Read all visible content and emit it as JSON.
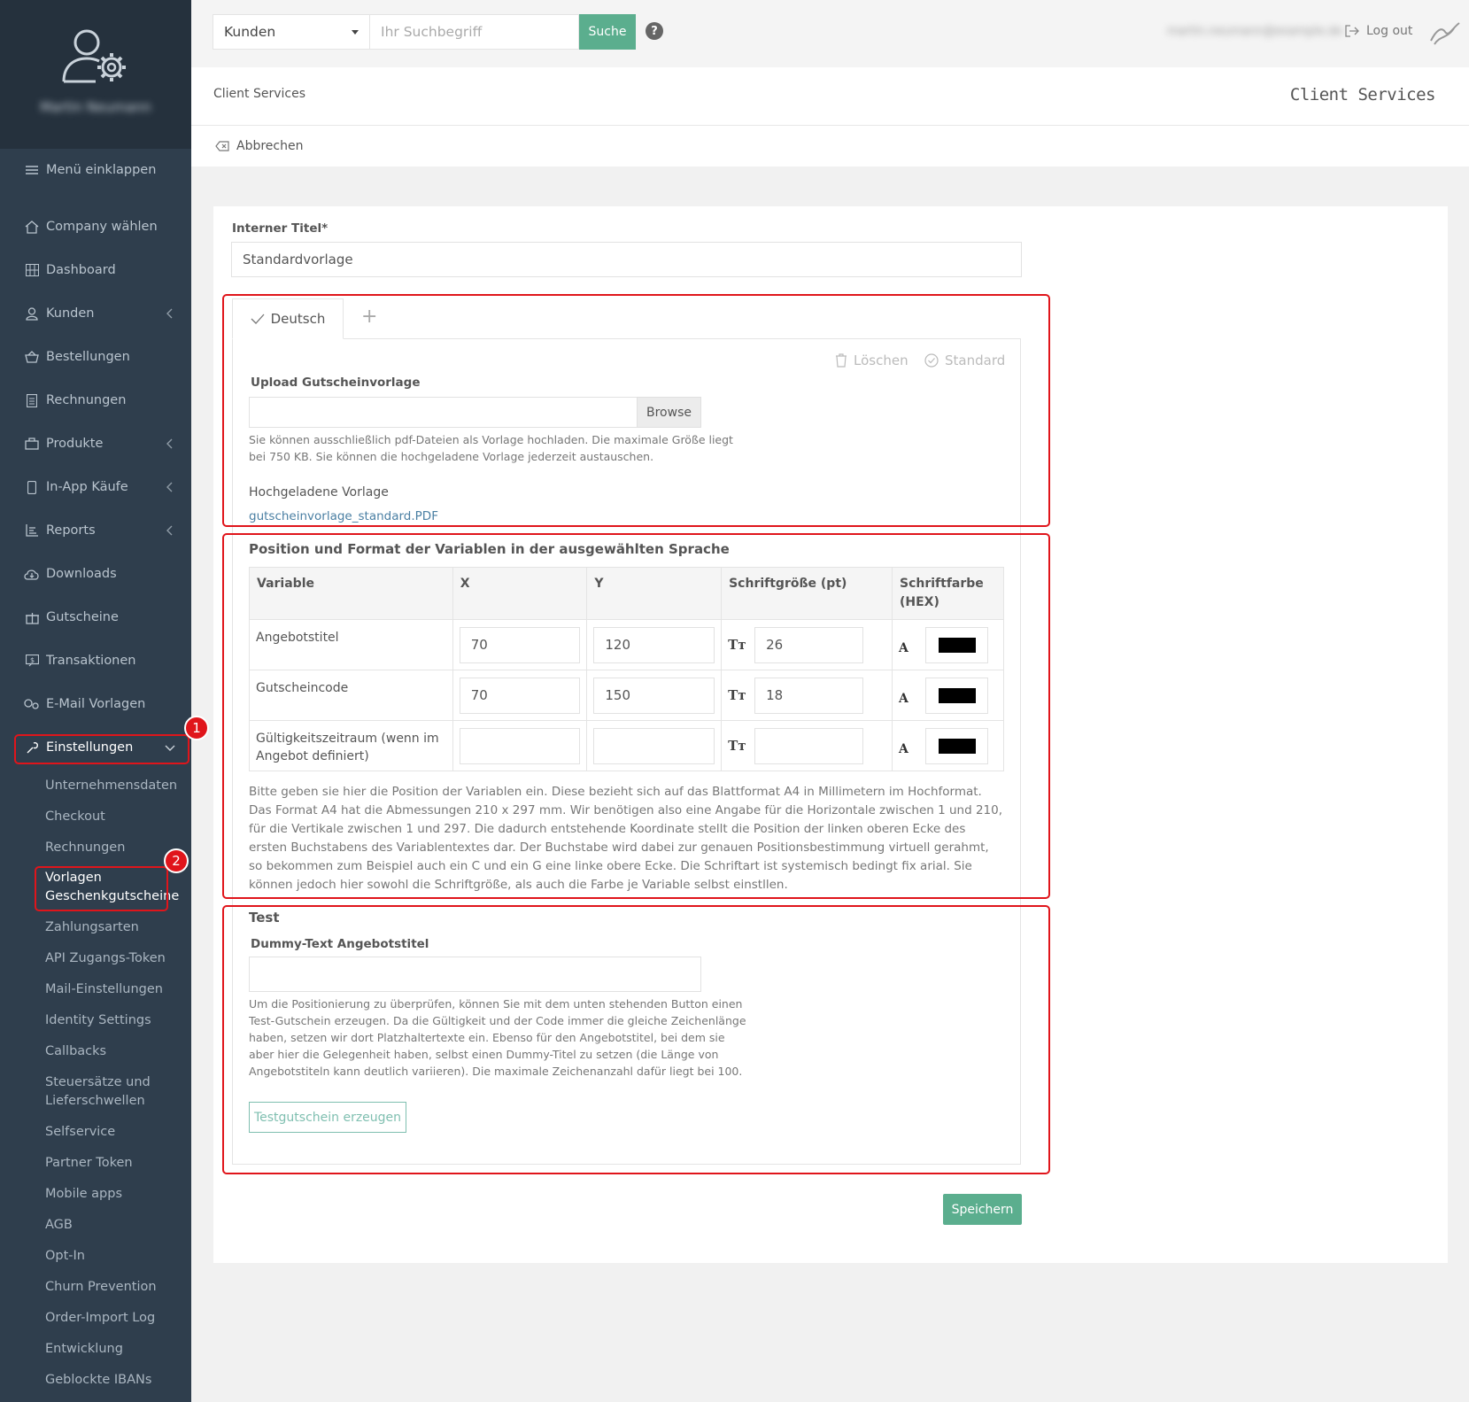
{
  "sidebar": {
    "user_name": "Martin Neumann",
    "collapse": "Menü einklappen",
    "items": [
      {
        "label": "Company wählen",
        "icon": "home-icon"
      },
      {
        "label": "Dashboard",
        "icon": "grid-icon"
      },
      {
        "label": "Kunden",
        "icon": "user-icon"
      },
      {
        "label": "Bestellungen",
        "icon": "basket-icon"
      },
      {
        "label": "Rechnungen",
        "icon": "invoice-icon"
      },
      {
        "label": "Produkte",
        "icon": "box-icon"
      },
      {
        "label": "In-App Käufe",
        "icon": "phone-icon"
      },
      {
        "label": "Reports",
        "icon": "report-icon"
      },
      {
        "label": "Downloads",
        "icon": "cloud-download-icon"
      },
      {
        "label": "Gutscheine",
        "icon": "gift-icon"
      },
      {
        "label": "Transaktionen",
        "icon": "transaction-icon"
      },
      {
        "label": "E-Mail Vorlagen",
        "icon": "mail-template-icon"
      },
      {
        "label": "Einstellungen",
        "icon": "wrench-icon"
      }
    ],
    "sub_items": [
      "Unternehmensdaten",
      "Checkout",
      "Rechnungen",
      "Vorlagen Geschenkgutscheine",
      "Zahlungsarten",
      "API Zugangs-Token",
      "Mail-Einstellungen",
      "Identity Settings",
      "Callbacks",
      "Steuersätze und Lieferschwellen",
      "Selfservice",
      "Partner Token",
      "Mobile apps",
      "AGB",
      "Opt-In",
      "Churn Prevention",
      "Order-Import Log",
      "Entwicklung",
      "Geblockte IBANs"
    ],
    "sub_active_line1": "Vorlagen",
    "sub_active_line2": "Geschenkgutscheine",
    "sub_multi_line1": "Steuersätze und",
    "sub_multi_line2": "Lieferschwellen",
    "badge1": "1",
    "badge2": "2"
  },
  "topbar": {
    "select_value": "Kunden",
    "search_placeholder": "Ihr Suchbegriff",
    "search_button": "Suche",
    "help": "?",
    "user_email": "martin.neumann@example.de",
    "logout": "Log out"
  },
  "breadcrumb": "Client Services",
  "header_right": "Client Services",
  "cancel": "Abbrechen",
  "form": {
    "title_label": "Interner Titel",
    "title_required": "*",
    "title_value": "Standardvorlage",
    "tab_active": "Deutsch",
    "tab_add": "+",
    "delete": "Löschen",
    "standard": "Standard",
    "upload_label": "Upload Gutscheinvorlage",
    "browse": "Browse",
    "upload_help_1": "Sie können ausschließlich pdf-Dateien als Vorlage hochladen. Die maximale Größe liegt",
    "upload_help_2": "bei 750 KB. Sie können die hochgeladene Vorlage jederzeit austauschen.",
    "uploaded_label": "Hochgeladene Vorlage",
    "uploaded_file": "gutscheinvorlage_standard.PDF",
    "section_title": "Position und Format der Variablen in der ausgewählten Sprache",
    "columns": [
      "Variable",
      "X",
      "Y",
      "Schriftgröße (pt)",
      "Schriftfarbe (HEX)"
    ],
    "col5_line1": "Schriftfarbe",
    "col5_line2": "(HEX)",
    "rows": [
      {
        "name": "Angebotstitel",
        "x": "70",
        "y": "120",
        "size": "26",
        "color": "#000000"
      },
      {
        "name": "Gutscheincode",
        "x": "70",
        "y": "150",
        "size": "18",
        "color": "#000000"
      },
      {
        "name": "Gültigkeitszeitraum (wenn im Angebot definiert)",
        "x": "",
        "y": "",
        "size": "",
        "color": "#000000"
      }
    ],
    "row3_line1": "Gültigkeitszeitraum (wenn im",
    "row3_line2": "Angebot definiert)",
    "position_help": "Bitte geben sie hier die Position der Variablen ein. Diese bezieht sich auf das Blattformat A4 in Millimetern im Hochformat. Das Format A4 hat die Abmessungen 210 x 297 mm. Wir benötigen also eine Angabe für die Horizontale zwischen 1 und 210, für die Vertikale zwischen 1 und 297. Die dadurch entstehende Koordinate stellt die Position der linken oberen Ecke des ersten Buchstabens des Variablentextes dar. Der Buchstabe wird dabei zur genauen Positionsbestimmung virtuell gerahmt, so bekommen zum Beispiel auch ein C und ein G eine linke obere Ecke. Die Schriftart ist systemisch bedingt fix arial. Sie können jedoch hier sowohl die Schriftgröße, als auch die Farbe je Variable selbst einstllen.",
    "test_title": "Test",
    "dummy_label": "Dummy-Text Angebotstitel",
    "dummy_value": "",
    "test_help": [
      "Um die Positionierung zu überprüfen, können Sie mit dem unten stehenden Button einen",
      "Test-Gutschein erzeugen. Da die Gültigkeit und der Code immer die gleiche Zeichenlänge",
      "haben, setzen wir dort Platzhaltertexte ein. Ebenso für den Angebotstitel, bei dem sie",
      "aber hier die Gelegenheit haben, selbst einen Dummy-Titel zu setzen (die Länge von",
      "Angebotstiteln kann deutlich variieren). Die maximale Zeichenanzahl dafür liegt bei 100."
    ],
    "test_button": "Testgutschein erzeugen",
    "save": "Speichern"
  },
  "colors": {
    "sidebar": "#2f3e4d",
    "accent": "#5bae8e",
    "highlight": "#e0151b"
  }
}
